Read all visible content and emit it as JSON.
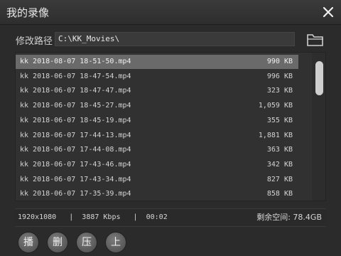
{
  "window": {
    "title": "我的录像"
  },
  "path": {
    "label": "修改路径",
    "value": "C:\\KK_Movies\\"
  },
  "files": [
    {
      "name": "kk 2018-08-07 18-51-50.mp4",
      "size": "990 KB",
      "selected": true
    },
    {
      "name": "kk 2018-06-07 18-47-54.mp4",
      "size": "996 KB"
    },
    {
      "name": "kk 2018-06-07 18-47-47.mp4",
      "size": "323 KB"
    },
    {
      "name": "kk 2018-06-07 18-45-27.mp4",
      "size": "1,059 KB"
    },
    {
      "name": "kk 2018-06-07 18-45-19.mp4",
      "size": "355 KB"
    },
    {
      "name": "kk 2018-06-07 17-44-13.mp4",
      "size": "1,881 KB"
    },
    {
      "name": "kk 2018-06-07 17-44-08.mp4",
      "size": "363 KB"
    },
    {
      "name": "kk 2018-06-07 17-43-46.mp4",
      "size": "342 KB"
    },
    {
      "name": "kk 2018-06-07 17-43-34.mp4",
      "size": "827 KB"
    },
    {
      "name": "kk 2018-06-07 17-35-39.mp4",
      "size": "858 KB"
    }
  ],
  "status": {
    "info": "1920x1080   |  3887 Kbps   |  00:02",
    "free_space": "剩余空间: 78.4GB"
  },
  "actions": [
    {
      "label": "播"
    },
    {
      "label": "删"
    },
    {
      "label": "压"
    },
    {
      "label": "上"
    }
  ],
  "colors": {
    "background": "#2b2b2b",
    "selected_row": "#6a6a6a",
    "scroll_thumb": "#cfcfcf"
  }
}
